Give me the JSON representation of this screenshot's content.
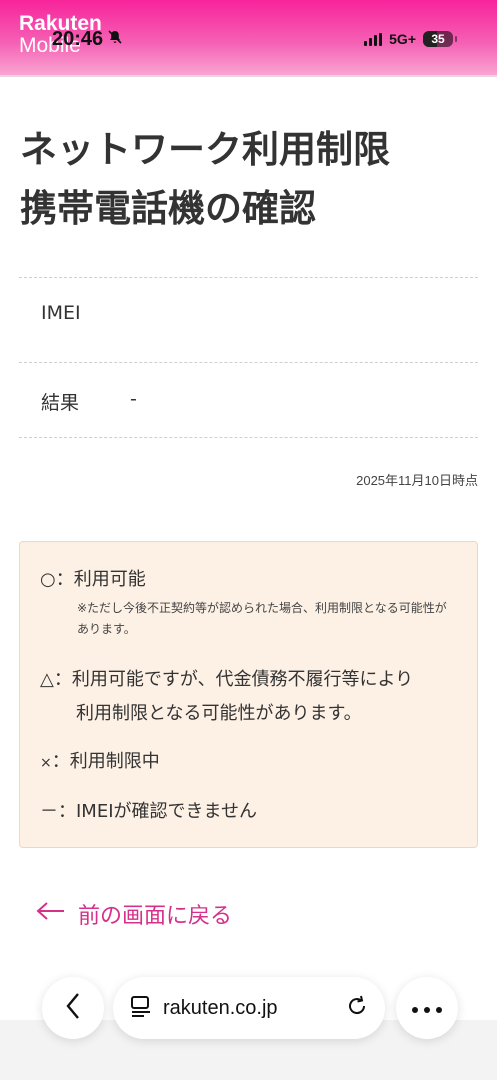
{
  "status_bar": {
    "brand_line1": "Rakuten",
    "brand_line2": "Mobile",
    "time": "20:46",
    "network": "5G+",
    "battery": "35"
  },
  "title": {
    "line1": "ネットワーク利用制限",
    "line2": "携帯電話機の確認"
  },
  "info_rows": [
    {
      "label": "IMEI",
      "value": ""
    },
    {
      "label": "結果",
      "value": "-"
    }
  ],
  "timestamp": "2025年11月10日時点",
  "legend": {
    "available_symbol": "○",
    "available_text": "：利用可能",
    "available_note": "※ただし今後不正契約等が認められた場合、利用制限となる可能性があります。",
    "warning_symbol": "△",
    "warning_text_line1": "：利用可能ですが、代金債務不履行等により",
    "warning_text_line2": "利用制限となる可能性があります。",
    "restricted_symbol": "×",
    "restricted_text": "：利用制限中",
    "unknown_symbol": "－",
    "unknown_text": "：IMEIが確認できません"
  },
  "back_link": "前の画面に戻る",
  "browser": {
    "url": "rakuten.co.jp"
  },
  "colors": {
    "brand_pink": "#f7239b",
    "link_pink": "#d5308a",
    "legend_bg": "#fdf1e6"
  }
}
